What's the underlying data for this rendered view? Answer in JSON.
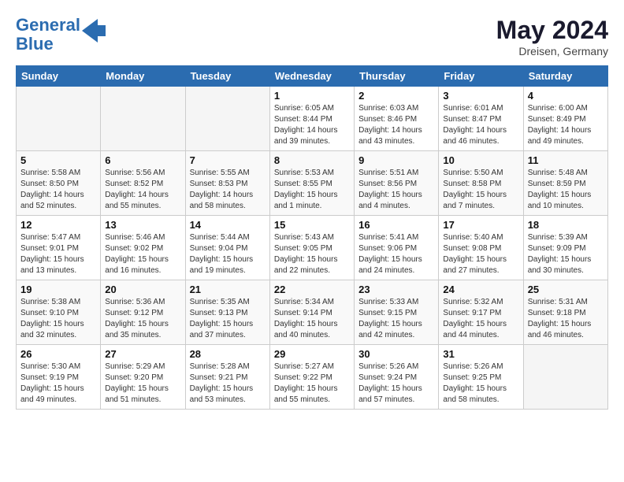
{
  "header": {
    "logo_line1": "General",
    "logo_line2": "Blue",
    "month": "May 2024",
    "location": "Dreisen, Germany"
  },
  "days_of_week": [
    "Sunday",
    "Monday",
    "Tuesday",
    "Wednesday",
    "Thursday",
    "Friday",
    "Saturday"
  ],
  "weeks": [
    [
      {
        "day": "",
        "info": ""
      },
      {
        "day": "",
        "info": ""
      },
      {
        "day": "",
        "info": ""
      },
      {
        "day": "1",
        "info": "Sunrise: 6:05 AM\nSunset: 8:44 PM\nDaylight: 14 hours\nand 39 minutes."
      },
      {
        "day": "2",
        "info": "Sunrise: 6:03 AM\nSunset: 8:46 PM\nDaylight: 14 hours\nand 43 minutes."
      },
      {
        "day": "3",
        "info": "Sunrise: 6:01 AM\nSunset: 8:47 PM\nDaylight: 14 hours\nand 46 minutes."
      },
      {
        "day": "4",
        "info": "Sunrise: 6:00 AM\nSunset: 8:49 PM\nDaylight: 14 hours\nand 49 minutes."
      }
    ],
    [
      {
        "day": "5",
        "info": "Sunrise: 5:58 AM\nSunset: 8:50 PM\nDaylight: 14 hours\nand 52 minutes."
      },
      {
        "day": "6",
        "info": "Sunrise: 5:56 AM\nSunset: 8:52 PM\nDaylight: 14 hours\nand 55 minutes."
      },
      {
        "day": "7",
        "info": "Sunrise: 5:55 AM\nSunset: 8:53 PM\nDaylight: 14 hours\nand 58 minutes."
      },
      {
        "day": "8",
        "info": "Sunrise: 5:53 AM\nSunset: 8:55 PM\nDaylight: 15 hours\nand 1 minute."
      },
      {
        "day": "9",
        "info": "Sunrise: 5:51 AM\nSunset: 8:56 PM\nDaylight: 15 hours\nand 4 minutes."
      },
      {
        "day": "10",
        "info": "Sunrise: 5:50 AM\nSunset: 8:58 PM\nDaylight: 15 hours\nand 7 minutes."
      },
      {
        "day": "11",
        "info": "Sunrise: 5:48 AM\nSunset: 8:59 PM\nDaylight: 15 hours\nand 10 minutes."
      }
    ],
    [
      {
        "day": "12",
        "info": "Sunrise: 5:47 AM\nSunset: 9:01 PM\nDaylight: 15 hours\nand 13 minutes."
      },
      {
        "day": "13",
        "info": "Sunrise: 5:46 AM\nSunset: 9:02 PM\nDaylight: 15 hours\nand 16 minutes."
      },
      {
        "day": "14",
        "info": "Sunrise: 5:44 AM\nSunset: 9:04 PM\nDaylight: 15 hours\nand 19 minutes."
      },
      {
        "day": "15",
        "info": "Sunrise: 5:43 AM\nSunset: 9:05 PM\nDaylight: 15 hours\nand 22 minutes."
      },
      {
        "day": "16",
        "info": "Sunrise: 5:41 AM\nSunset: 9:06 PM\nDaylight: 15 hours\nand 24 minutes."
      },
      {
        "day": "17",
        "info": "Sunrise: 5:40 AM\nSunset: 9:08 PM\nDaylight: 15 hours\nand 27 minutes."
      },
      {
        "day": "18",
        "info": "Sunrise: 5:39 AM\nSunset: 9:09 PM\nDaylight: 15 hours\nand 30 minutes."
      }
    ],
    [
      {
        "day": "19",
        "info": "Sunrise: 5:38 AM\nSunset: 9:10 PM\nDaylight: 15 hours\nand 32 minutes."
      },
      {
        "day": "20",
        "info": "Sunrise: 5:36 AM\nSunset: 9:12 PM\nDaylight: 15 hours\nand 35 minutes."
      },
      {
        "day": "21",
        "info": "Sunrise: 5:35 AM\nSunset: 9:13 PM\nDaylight: 15 hours\nand 37 minutes."
      },
      {
        "day": "22",
        "info": "Sunrise: 5:34 AM\nSunset: 9:14 PM\nDaylight: 15 hours\nand 40 minutes."
      },
      {
        "day": "23",
        "info": "Sunrise: 5:33 AM\nSunset: 9:15 PM\nDaylight: 15 hours\nand 42 minutes."
      },
      {
        "day": "24",
        "info": "Sunrise: 5:32 AM\nSunset: 9:17 PM\nDaylight: 15 hours\nand 44 minutes."
      },
      {
        "day": "25",
        "info": "Sunrise: 5:31 AM\nSunset: 9:18 PM\nDaylight: 15 hours\nand 46 minutes."
      }
    ],
    [
      {
        "day": "26",
        "info": "Sunrise: 5:30 AM\nSunset: 9:19 PM\nDaylight: 15 hours\nand 49 minutes."
      },
      {
        "day": "27",
        "info": "Sunrise: 5:29 AM\nSunset: 9:20 PM\nDaylight: 15 hours\nand 51 minutes."
      },
      {
        "day": "28",
        "info": "Sunrise: 5:28 AM\nSunset: 9:21 PM\nDaylight: 15 hours\nand 53 minutes."
      },
      {
        "day": "29",
        "info": "Sunrise: 5:27 AM\nSunset: 9:22 PM\nDaylight: 15 hours\nand 55 minutes."
      },
      {
        "day": "30",
        "info": "Sunrise: 5:26 AM\nSunset: 9:24 PM\nDaylight: 15 hours\nand 57 minutes."
      },
      {
        "day": "31",
        "info": "Sunrise: 5:26 AM\nSunset: 9:25 PM\nDaylight: 15 hours\nand 58 minutes."
      },
      {
        "day": "",
        "info": ""
      }
    ]
  ]
}
